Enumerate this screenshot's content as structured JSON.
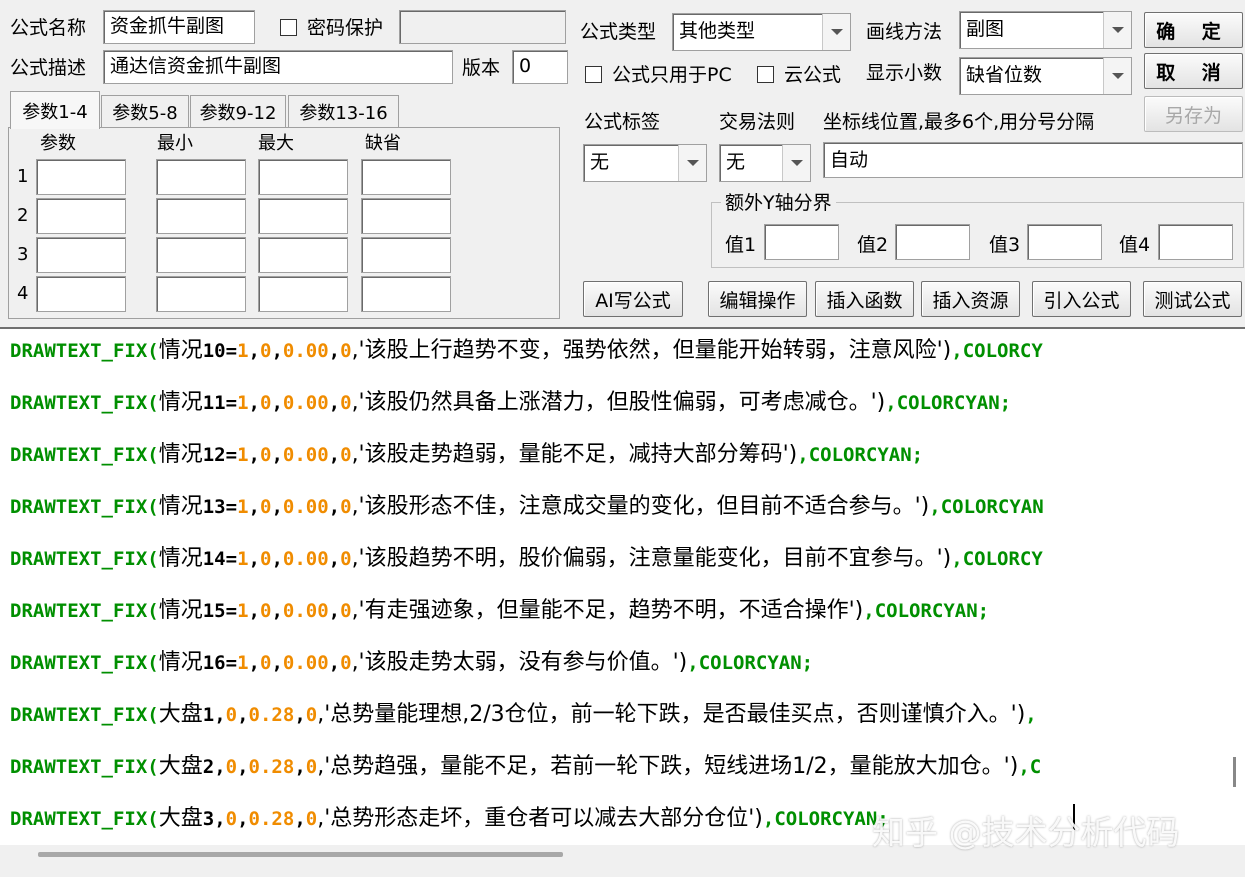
{
  "form": {
    "name_label": "公式名称",
    "name_value": "资金抓牛副图",
    "password_label": "密码保护",
    "desc_label": "公式描述",
    "desc_value": "通达信资金抓牛副图",
    "version_label": "版本",
    "version_value": "0",
    "type_label": "公式类型",
    "type_value": "其他类型",
    "draw_label": "画线方法",
    "draw_value": "副图",
    "pc_only_label": "公式只用于PC",
    "cloud_label": "云公式",
    "decimals_label": "显示小数",
    "decimals_value": "缺省位数",
    "tag_label": "公式标签",
    "tag_value": "无",
    "rule_label": "交易法则",
    "rule_value": "无",
    "axis_label": "坐标线位置,最多6个,用分号分隔",
    "axis_value": "自动",
    "yaxis_group_label": "额外Y轴分界",
    "y_values": [
      "值1",
      "值2",
      "值3",
      "值4"
    ]
  },
  "buttons": {
    "ok": "确 定",
    "cancel": "取 消",
    "save_as": "另存为",
    "ai": "AI写公式",
    "edit": "编辑操作",
    "insert_func": "插入函数",
    "insert_res": "插入资源",
    "import": "引入公式",
    "test": "测试公式"
  },
  "tabs": [
    "参数1-4",
    "参数5-8",
    "参数9-12",
    "参数13-16"
  ],
  "params": {
    "headers": [
      "参数",
      "最小",
      "最大",
      "缺省"
    ],
    "rows": [
      "1",
      "2",
      "3",
      "4"
    ]
  },
  "code_lines": [
    {
      "fn": "DRAWTEXT_FIX(",
      "var": "情况",
      "idx": "10",
      "eq": "=",
      "one": "1",
      "args": [
        ",",
        "0",
        ",",
        "0.00",
        ",",
        "0"
      ],
      "text": ",'该股上行趋势不变，强势依然，但量能开始转弱，注意风险')",
      "tail": ",COLORCY"
    },
    {
      "fn": "DRAWTEXT_FIX(",
      "var": "情况",
      "idx": "11",
      "eq": "=",
      "one": "1",
      "args": [
        ",",
        "0",
        ",",
        "0.00",
        ",",
        "0"
      ],
      "text": ",'该股仍然具备上涨潜力，但股性偏弱，可考虑减仓。')",
      "tail": ",COLORCYAN;"
    },
    {
      "fn": "DRAWTEXT_FIX(",
      "var": "情况",
      "idx": "12",
      "eq": "=",
      "one": "1",
      "args": [
        ",",
        "0",
        ",",
        "0.00",
        ",",
        "0"
      ],
      "text": ",'该股走势趋弱，量能不足，减持大部分筹码')",
      "tail": ",COLORCYAN;"
    },
    {
      "fn": "DRAWTEXT_FIX(",
      "var": "情况",
      "idx": "13",
      "eq": "=",
      "one": "1",
      "args": [
        ",",
        "0",
        ",",
        "0.00",
        ",",
        "0"
      ],
      "text": ",'该股形态不佳，注意成交量的变化，但目前不适合参与。')",
      "tail": ",COLORCYAN"
    },
    {
      "fn": "DRAWTEXT_FIX(",
      "var": "情况",
      "idx": "14",
      "eq": "=",
      "one": "1",
      "args": [
        ",",
        "0",
        ",",
        "0.00",
        ",",
        "0"
      ],
      "text": ",'该股趋势不明，股价偏弱，注意量能变化，目前不宜参与。')",
      "tail": ",COLORCY"
    },
    {
      "fn": "DRAWTEXT_FIX(",
      "var": "情况",
      "idx": "15",
      "eq": "=",
      "one": "1",
      "args": [
        ",",
        "0",
        ",",
        "0.00",
        ",",
        "0"
      ],
      "text": ",'有走强迹象，但量能不足，趋势不明，不适合操作')",
      "tail": ",COLORCYAN;"
    },
    {
      "fn": "DRAWTEXT_FIX(",
      "var": "情况",
      "idx": "16",
      "eq": "=",
      "one": "1",
      "args": [
        ",",
        "0",
        ",",
        "0.00",
        ",",
        "0"
      ],
      "text": ",'该股走势太弱，没有参与价值。')",
      "tail": ",COLORCYAN;"
    },
    {
      "fn": "DRAWTEXT_FIX(",
      "var": "大盘",
      "idx": "1",
      "eq": "",
      "one": "",
      "args": [
        ",",
        "0",
        ",",
        "0.28",
        ",",
        "0"
      ],
      "text": ",'总势量能理想,2/3仓位，前一轮下跌，是否最佳买点，否则谨慎介入。')",
      "tail": ","
    },
    {
      "fn": "DRAWTEXT_FIX(",
      "var": "大盘",
      "idx": "2",
      "eq": "",
      "one": "",
      "args": [
        ",",
        "0",
        ",",
        "0.28",
        ",",
        "0"
      ],
      "text": ",'总势趋强，量能不足，若前一轮下跌，短线进场1/2，量能放大加仓。')",
      "tail": ",C"
    },
    {
      "fn": "DRAWTEXT_FIX(",
      "var": "大盘",
      "idx": "3",
      "eq": "",
      "one": "",
      "args": [
        ",",
        "0",
        ",",
        "0.28",
        ",",
        "0"
      ],
      "text": ",'总势形态走坏，重仓者可以减去大部分仓位')",
      "tail": ",COLORCYAN;"
    }
  ],
  "watermark": "知乎 @技术分析代码",
  "colors": {
    "keyword": "#008f00",
    "number": "#f08c00",
    "text": "#000000"
  }
}
